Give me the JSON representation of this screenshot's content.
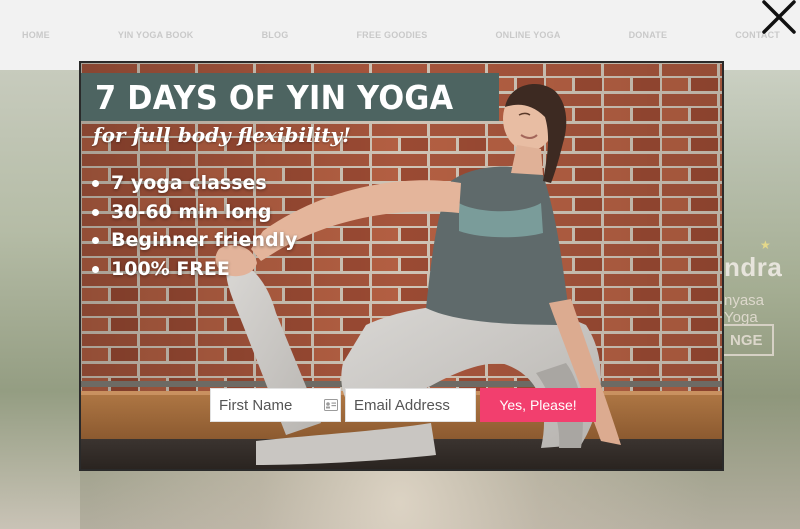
{
  "nav": {
    "items": [
      "HOME",
      "YIN YOGA BOOK",
      "BLOG",
      "FREE GOODIES",
      "ONLINE YOGA",
      "DONATE",
      "CONTACT"
    ]
  },
  "background_hero": {
    "name_fragment": "ndra",
    "subtitle_fragment": "nyasa Yoga",
    "button_fragment": "NGE"
  },
  "popup": {
    "title": "7 DAYS OF YIN YOGA",
    "subtitle": "for full body flexibility!",
    "features": [
      "7 yoga classes",
      "30-60 min long",
      "Beginner friendly",
      "100% FREE"
    ],
    "form": {
      "first_name_placeholder": "First Name",
      "email_placeholder": "Email Address",
      "submit_label": "Yes, Please!"
    }
  },
  "colors": {
    "title_bg": "#4d6461",
    "submit_bg": "#f23f6e"
  },
  "icons": {
    "close": "close-icon",
    "contact_card": "contact-card-icon"
  }
}
